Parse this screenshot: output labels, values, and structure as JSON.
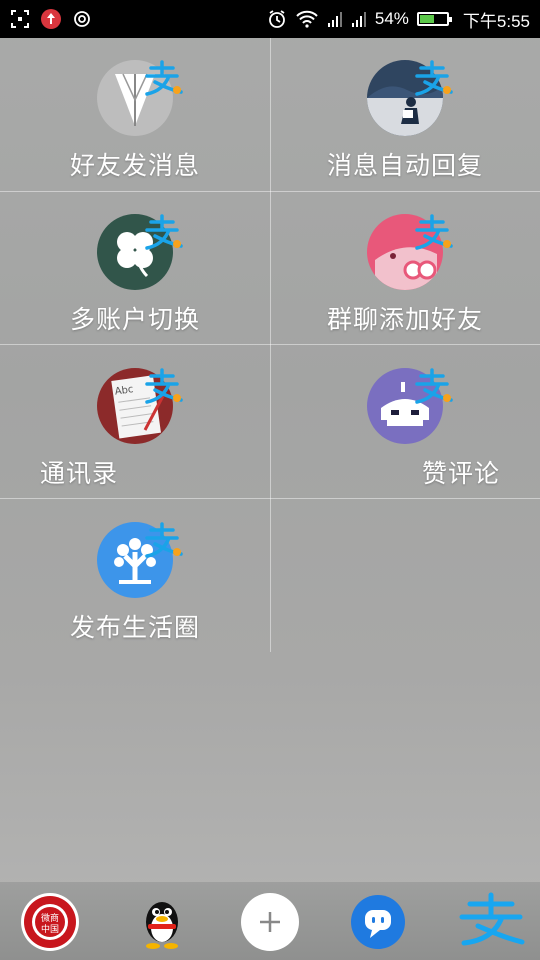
{
  "status_bar": {
    "battery_percent": "54%",
    "battery_level": 0.54,
    "time": "下午5:55",
    "icons": [
      "screenshot-icon",
      "upload-notification-icon",
      "target-icon",
      "alarm-icon",
      "wifi-icon",
      "signal-icon",
      "signal-icon",
      "battery-icon"
    ]
  },
  "shortcuts": [
    {
      "label": "好友发消息",
      "icon": "paper-plane-icon",
      "color": "#bdbdbd"
    },
    {
      "label": "消息自动回复",
      "icon": "reading-person-icon",
      "color": "#2f4560"
    },
    {
      "label": "多账户切换",
      "icon": "clover-icon",
      "color": "#31554a"
    },
    {
      "label": "群聊添加好友",
      "icon": "pig-icon",
      "color": "#e8587a"
    },
    {
      "label": "通讯录",
      "icon": "address-book-icon",
      "color": "#8c2a2a"
    },
    {
      "label": "赞评论",
      "icon": "robot-icon",
      "color": "#7a6fc0"
    },
    {
      "label": "发布生活圈",
      "icon": "tree-icon",
      "color": "#3d95ea"
    }
  ],
  "dock": {
    "items": [
      "微商中国",
      "qq-penguin-icon",
      "add-icon",
      "chat-bubble-icon",
      "alipay-icon"
    ],
    "badge_text": "微商\n中国"
  }
}
